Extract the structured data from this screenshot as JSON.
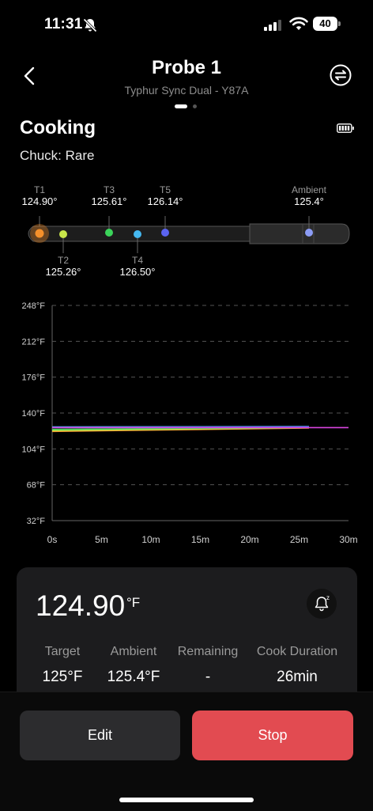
{
  "status_bar": {
    "time": "11:31",
    "battery": "40"
  },
  "header": {
    "title": "Probe 1",
    "subtitle": "Typhur Sync Dual - Y87A"
  },
  "section": {
    "title": "Cooking",
    "cut": "Chuck: Rare"
  },
  "probe": {
    "sensors": [
      {
        "name": "T1",
        "value": "124.90°",
        "color": "#f5902b"
      },
      {
        "name": "T2",
        "value": "125.26°",
        "color": "#c8e64a"
      },
      {
        "name": "T3",
        "value": "125.61°",
        "color": "#3bd45a"
      },
      {
        "name": "T4",
        "value": "126.50°",
        "color": "#45b8f0"
      },
      {
        "name": "T5",
        "value": "126.14°",
        "color": "#5a63f0"
      },
      {
        "name": "Ambient",
        "value": "125.4°",
        "color": "#8c9cf5"
      }
    ]
  },
  "chart_data": {
    "type": "line",
    "x_ticks": [
      "0s",
      "5m",
      "10m",
      "15m",
      "20m",
      "25m",
      "30m"
    ],
    "y_ticks": [
      "248°F",
      "212°F",
      "176°F",
      "140°F",
      "104°F",
      "68°F",
      "32°F"
    ],
    "xlim": [
      0,
      30
    ],
    "ylim": [
      32,
      248
    ],
    "grid": true,
    "series": [
      {
        "color": "#f5902b",
        "x": [
          0,
          26
        ],
        "y": [
          121.5,
          124.9
        ]
      },
      {
        "color": "#c8e64a",
        "x": [
          0,
          26
        ],
        "y": [
          122.3,
          125.3
        ]
      },
      {
        "color": "#3bd45a",
        "x": [
          0,
          26
        ],
        "y": [
          123.6,
          125.6
        ]
      },
      {
        "color": "#45b8f0",
        "x": [
          0,
          26
        ],
        "y": [
          126.0,
          126.5
        ]
      },
      {
        "color": "#5a63f0",
        "x": [
          0,
          26
        ],
        "y": [
          125.5,
          126.1
        ]
      },
      {
        "color": "#d845e0",
        "x": [
          0,
          30
        ],
        "y": [
          125.4,
          125.4
        ]
      }
    ]
  },
  "card": {
    "current_temp": "124.90",
    "unit": "°F",
    "stats": [
      {
        "label": "Target",
        "value": "125°F"
      },
      {
        "label": "Ambient",
        "value": "125.4°F"
      },
      {
        "label": "Remaining",
        "value": "-"
      },
      {
        "label": "Cook Duration",
        "value": "26min"
      }
    ]
  },
  "actions": {
    "edit": "Edit",
    "stop": "Stop"
  }
}
